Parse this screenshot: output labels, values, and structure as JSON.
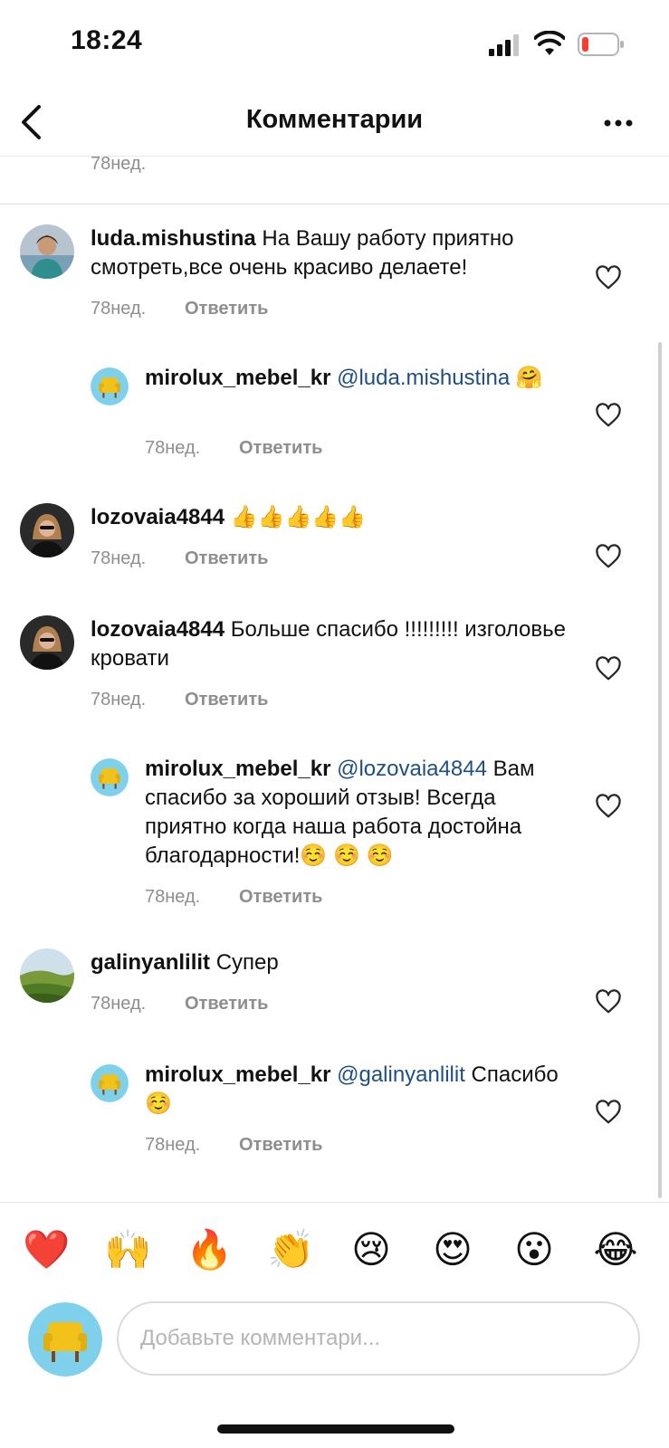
{
  "status_bar": {
    "time": "18:24",
    "battery_color": "#ff3b30"
  },
  "header": {
    "title": "Комментарии",
    "back_icon": "chevron-left-icon",
    "more_icon": "ellipsis-icon"
  },
  "previous": {
    "time": "78нед."
  },
  "comments": [
    {
      "user": "luda.mishustina",
      "mention": "",
      "text": "На Вашу работу приятно смотреть,все очень красиво делаете!",
      "time": "78нед.",
      "reply": "Ответить",
      "reply_level": 0
    },
    {
      "user": "mirolux_mebel_kr",
      "mention": "@luda.mishustina",
      "text": "🤗",
      "time": "78нед.",
      "reply": "Ответить",
      "reply_level": 1
    },
    {
      "user": "lozovaia4844",
      "mention": "",
      "text": "👍👍👍👍👍",
      "time": "78нед.",
      "reply": "Ответить",
      "reply_level": 0
    },
    {
      "user": "lozovaia4844",
      "mention": "",
      "text": "Больше спасибо !!!!!!!!! изголовье кровати",
      "time": "78нед.",
      "reply": "Ответить",
      "reply_level": 0
    },
    {
      "user": "mirolux_mebel_kr",
      "mention": "@lozovaia4844",
      "text": "Вам спасибо за хороший отзыв! Всегда приятно когда наша работа достойна благодарности!☺️ ☺️ ☺️",
      "time": "78нед.",
      "reply": "Ответить",
      "reply_level": 1
    },
    {
      "user": "galinyanlilit",
      "mention": "",
      "text": "Супер",
      "time": "78нед.",
      "reply": "Ответить",
      "reply_level": 0
    },
    {
      "user": "mirolux_mebel_kr",
      "mention": "@galinyanlilit",
      "text": "Спасибо☺️",
      "time": "78нед.",
      "reply": "Ответить",
      "reply_level": 1
    }
  ],
  "reactions": [
    "❤️",
    "🙌",
    "🔥",
    "👏",
    "😢",
    "😍",
    "😮",
    "😂"
  ],
  "composer": {
    "placeholder": "Добавьте комментари..."
  },
  "colors": {
    "mention": "#1f4f82",
    "meta": "#8e8e8e",
    "brand_avatar_bg": "#7fd0ea",
    "chair": "#f2c21b"
  }
}
